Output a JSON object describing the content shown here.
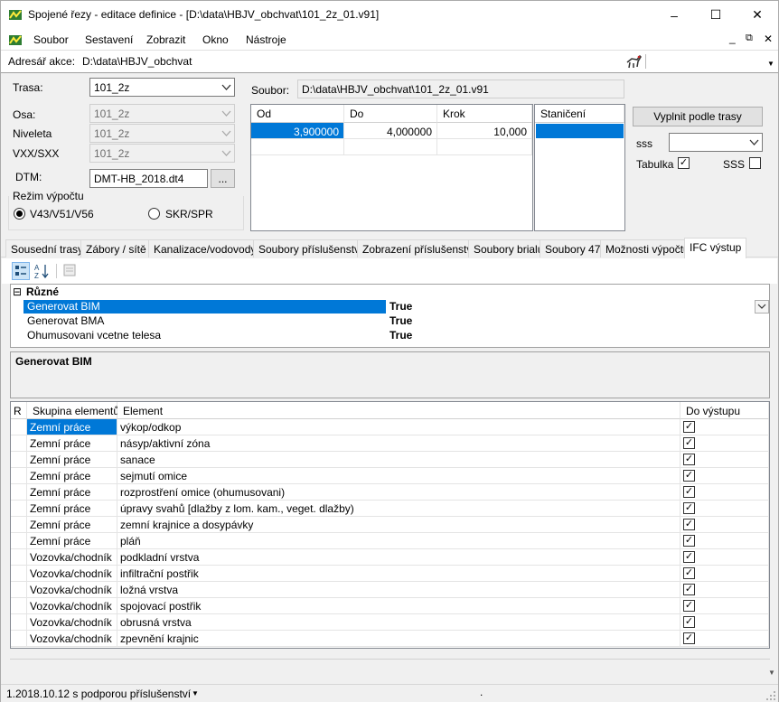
{
  "window": {
    "title": "Spojené řezy - editace definice - [D:\\data\\HBJV_obchvat\\101_2z_01.v91]",
    "controls": {
      "minimize": "–",
      "maximize": "☐",
      "close": "✕"
    }
  },
  "menu": {
    "items": [
      "Soubor",
      "Sestavení",
      "Zobrazit",
      "Okno",
      "Nástroje"
    ],
    "mdi_controls": {
      "minimize": "_",
      "restore": "⧉",
      "close": "✕"
    }
  },
  "address": {
    "label": "Adresář akce:",
    "value": "D:\\data\\HBJV_obchvat"
  },
  "form": {
    "trasa_label": "Trasa:",
    "trasa_value": "101_2z",
    "osa_label": "Osa:",
    "osa_value": "101_2z",
    "niveleta_label": "Niveleta",
    "niveleta_value": "101_2z",
    "vxx_label": "VXX/SXX",
    "vxx_value": "101_2z",
    "dtm_label": "DTM:",
    "dtm_value": "DMT-HB_2018.dt4",
    "dtm_browse": "...",
    "rezim_label": "Režim výpočtu",
    "radio1": "V43/V51/V56",
    "radio2": "SKR/SPR",
    "soubor_label": "Soubor:",
    "soubor_value": "D:\\data\\HBJV_obchvat\\101_2z_01.v91"
  },
  "interval_table": {
    "headers": [
      "Od",
      "Do",
      "Krok"
    ],
    "rows": [
      [
        "3,900000",
        "4,000000",
        "10,000"
      ]
    ]
  },
  "staniceni": {
    "header": "Staničení"
  },
  "right_panel": {
    "fill_button": "Vyplnit podle trasy",
    "sss_label": "sss",
    "sss_value": "",
    "tabulka_label": "Tabulka",
    "tabulka_checked": "✓",
    "sss2_label": "SSS",
    "sss2_checked": ""
  },
  "tabs": [
    "Sousední trasy",
    "Zábory / sítě",
    "Kanalizace/vodovody",
    "Soubory příslušenství",
    "Zobrazení příslušenství",
    "Soubory brialu",
    "Soubory 47",
    "Možnosti výpočtu",
    "IFC výstup"
  ],
  "properties": {
    "category": "Různé",
    "expand_glyph": "⊟",
    "rows": [
      {
        "name": "Generovat BIM",
        "value": "True"
      },
      {
        "name": "Generovat BMA",
        "value": "True"
      },
      {
        "name": "Ohumusovani vcetne telesa",
        "value": "True"
      }
    ],
    "description_title": "Generovat BIM"
  },
  "elements_table": {
    "headers": {
      "r": "R",
      "group": "Skupina elementů",
      "element": "Element",
      "output": "Do výstupu"
    },
    "check_glyph": "✓",
    "rows": [
      {
        "group": "Zemní práce",
        "element": "výkop/odkop"
      },
      {
        "group": "Zemní práce",
        "element": "násyp/aktivní zóna"
      },
      {
        "group": "Zemní práce",
        "element": "sanace"
      },
      {
        "group": "Zemní práce",
        "element": "sejmutí omice"
      },
      {
        "group": "Zemní práce",
        "element": "rozprostření omice (ohumusovani)"
      },
      {
        "group": "Zemní práce",
        "element": "úpravy svahů [dlažby z lom. kam., veget. dlažby)"
      },
      {
        "group": "Zemní práce",
        "element": "zemní krajnice a dosypávky"
      },
      {
        "group": "Zemní práce",
        "element": "pláň"
      },
      {
        "group": "Vozovka/chodník",
        "element": "podkladní vrstva"
      },
      {
        "group": "Vozovka/chodník",
        "element": "infiltrační postřik"
      },
      {
        "group": "Vozovka/chodník",
        "element": "ložná vrstva"
      },
      {
        "group": "Vozovka/chodník",
        "element": "spojovací postřik"
      },
      {
        "group": "Vozovka/chodník",
        "element": "obrusná vrstva"
      },
      {
        "group": "Vozovka/chodník",
        "element": "zpevnění krajnic"
      }
    ]
  },
  "status": {
    "version": "1.2018.10.12 s podporou příslušenství",
    "dot": "."
  }
}
